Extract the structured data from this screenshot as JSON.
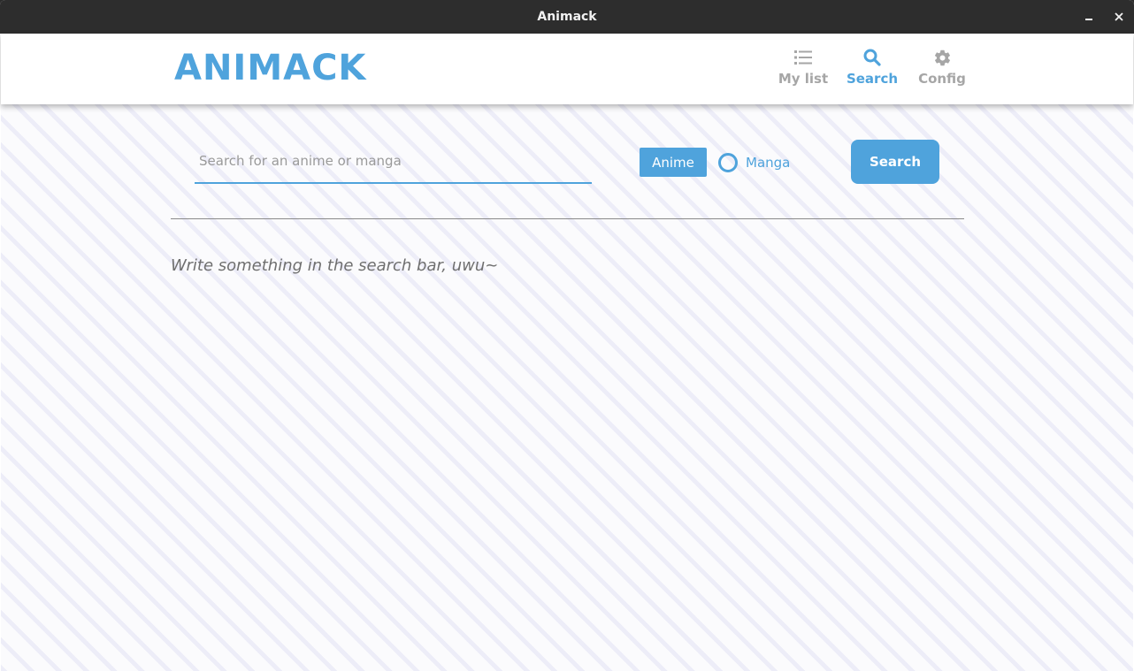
{
  "window": {
    "title": "Animack",
    "controls": [
      "minimize-icon",
      "close-icon"
    ]
  },
  "header": {
    "logo": "ANIMACK",
    "nav": [
      {
        "label": "My list",
        "icon": "list-icon",
        "active": false
      },
      {
        "label": "Search",
        "icon": "search-icon",
        "active": true
      },
      {
        "label": "Config",
        "icon": "gear-icon",
        "active": false
      }
    ]
  },
  "search": {
    "placeholder": "Search for an anime or manga",
    "value": "",
    "type_options": [
      {
        "label": "Anime",
        "selected": true
      },
      {
        "label": "Manga",
        "selected": false
      }
    ],
    "button_label": "Search"
  },
  "results": {
    "empty_message": "Write something in the search bar, uwu~"
  },
  "colors": {
    "accent": "#4fa3dc",
    "inactive_nav": "#a6a6a6",
    "titlebar": "#2d2d2d",
    "background": "#fbfbfd"
  }
}
